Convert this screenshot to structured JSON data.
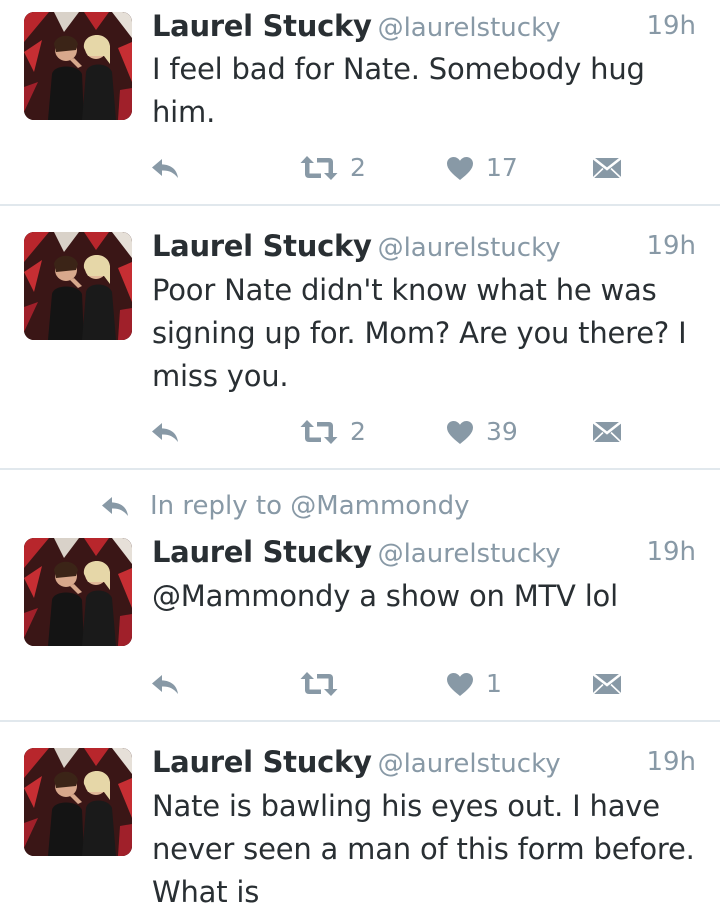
{
  "tweets": [
    {
      "name": "Laurel Stucky",
      "handle": "@laurelstucky",
      "time": "19h",
      "text_lines": [
        "I feel bad for Nate. Somebody hug",
        "him."
      ],
      "retweets": "2",
      "likes": "17",
      "reply_context": ""
    },
    {
      "name": "Laurel Stucky",
      "handle": "@laurelstucky",
      "time": "19h",
      "text_lines": [
        "Poor Nate didn't know what he was",
        "signing up for. Mom? Are you there? I",
        "miss you."
      ],
      "retweets": "2",
      "likes": "39",
      "reply_context": ""
    },
    {
      "name": "Laurel Stucky",
      "handle": "@laurelstucky",
      "time": "19h",
      "text_lines": [
        "@Mammondy a show on MTV lol"
      ],
      "retweets": "",
      "likes": "1",
      "reply_context": "In reply to @Mammondy"
    },
    {
      "name": "Laurel Stucky",
      "handle": "@laurelstucky",
      "time": "19h",
      "text_lines": [
        "Nate is bawling his eyes out. I have",
        "never seen a man of this form before.",
        "What is"
      ],
      "retweets": "",
      "likes": "",
      "reply_context": ""
    }
  ],
  "icons": {
    "reply": "reply-arrow-icon",
    "retweet": "retweet-icon",
    "like": "heart-icon",
    "dm": "envelope-icon",
    "avatar": "profile-photo"
  },
  "colors": {
    "text": "#292f33",
    "muted": "#8899a6",
    "divider": "#e1e8ed",
    "background": "#ffffff"
  }
}
